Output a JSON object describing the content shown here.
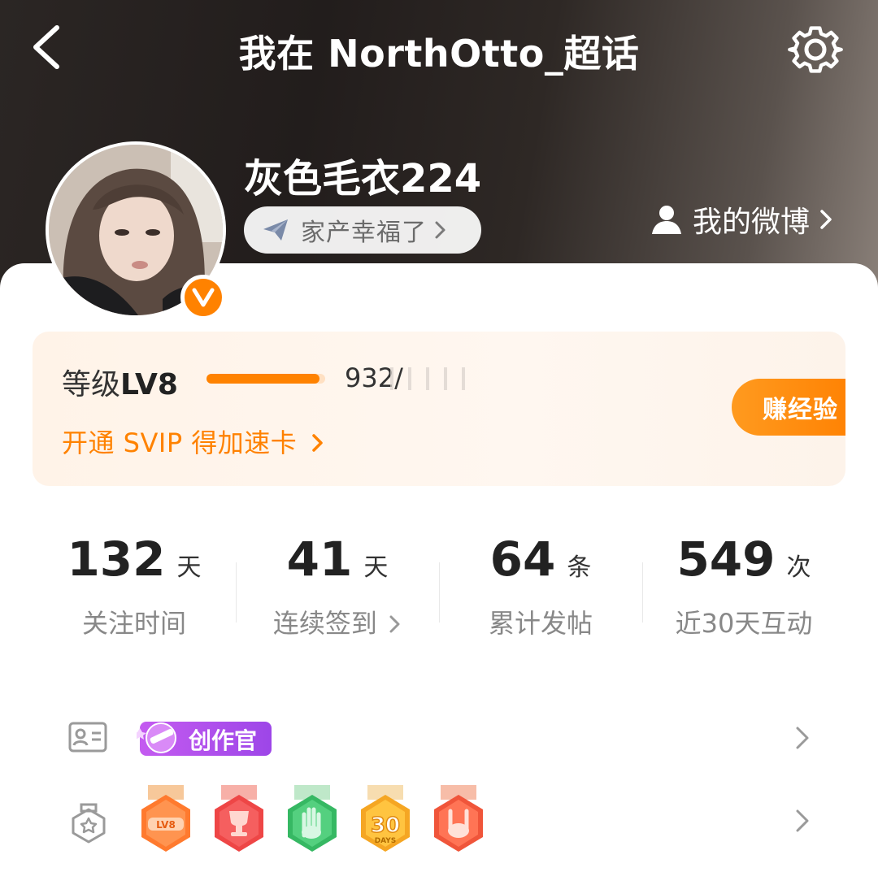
{
  "header": {
    "title": "我在 NorthOtto_超话"
  },
  "profile": {
    "username": "灰色毛衣224",
    "status_chip": "家产幸福了",
    "my_weibo_label": "我的微博"
  },
  "level": {
    "label_prefix": "等级",
    "level": "LV8",
    "progress": 0.95,
    "exp_current": "932/",
    "svip_link": "开通 SVIP 得加速卡",
    "earn_button": "赚经验"
  },
  "stats": [
    {
      "value": "132",
      "unit": "天",
      "label": "关注时间"
    },
    {
      "value": "41",
      "unit": "天",
      "label": "连续签到"
    },
    {
      "value": "64",
      "unit": "条",
      "label": "累计发帖"
    },
    {
      "value": "549",
      "unit": "次",
      "label": "近30天互动"
    }
  ],
  "badges": {
    "creator_tag": "创作官",
    "medals": [
      {
        "name": "lv8-medal",
        "text": "LV8",
        "color": "#ff7a2e"
      },
      {
        "name": "trophy-medal",
        "text": "",
        "color": "#f04a4a"
      },
      {
        "name": "hand-medal",
        "text": "",
        "color": "#3cc06a"
      },
      {
        "name": "30-days-medal",
        "text": "30",
        "sub": "DAYS",
        "color": "#ffb820"
      },
      {
        "name": "rock-hand-medal",
        "text": "",
        "color": "#f25a3a"
      }
    ]
  },
  "colors": {
    "accent": "#ff8200",
    "creator_purple": "#a64bea"
  }
}
